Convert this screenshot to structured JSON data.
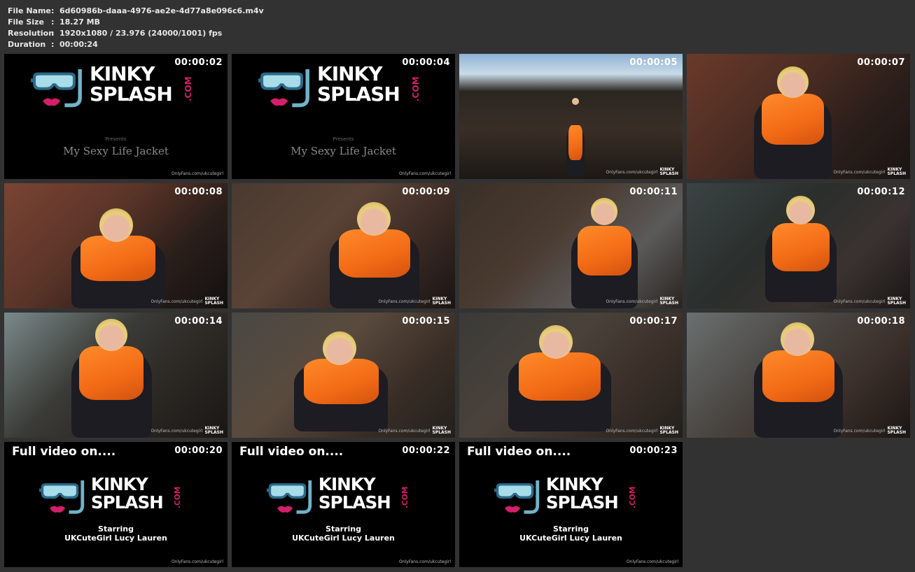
{
  "file_info": {
    "rows": [
      {
        "key": "File Name",
        "sep": ":",
        "value": "6d60986b-daaa-4976-ae2e-4d77a8e096c6.m4v"
      },
      {
        "key": "File Size",
        "sep": ":",
        "value": "18.27 MB"
      },
      {
        "key": "Resolution",
        "sep": ":",
        "value": "1920x1080 / 23.976 (24000/1001) fps"
      },
      {
        "key": "Duration",
        "sep": ":",
        "value": "00:00:24"
      }
    ]
  },
  "brand": {
    "line1": "KINKY",
    "line2": "SPLASH",
    "suffix": ".COM",
    "presents": "Presents",
    "subtitle": "My Sexy Life Jacket",
    "watermark": "OnlyFans.com/ukcutegirl",
    "full_video": "Full video on....",
    "starring_label": "Starring",
    "starring_name": "UKCuteGirl Lucy Lauren",
    "wm_logo1": "KINKY",
    "wm_logo2": "SPLASH"
  },
  "thumbnails": [
    {
      "timestamp": "00:00:02",
      "type": "title"
    },
    {
      "timestamp": "00:00:04",
      "type": "title"
    },
    {
      "timestamp": "00:00:05",
      "type": "scene"
    },
    {
      "timestamp": "00:00:07",
      "type": "scene"
    },
    {
      "timestamp": "00:00:08",
      "type": "scene"
    },
    {
      "timestamp": "00:00:09",
      "type": "scene"
    },
    {
      "timestamp": "00:00:11",
      "type": "scene"
    },
    {
      "timestamp": "00:00:12",
      "type": "scene"
    },
    {
      "timestamp": "00:00:14",
      "type": "scene"
    },
    {
      "timestamp": "00:00:15",
      "type": "scene"
    },
    {
      "timestamp": "00:00:17",
      "type": "scene"
    },
    {
      "timestamp": "00:00:18",
      "type": "scene"
    },
    {
      "timestamp": "00:00:20",
      "type": "end"
    },
    {
      "timestamp": "00:00:22",
      "type": "end"
    },
    {
      "timestamp": "00:00:23",
      "type": "end"
    }
  ],
  "colors": {
    "background": "#323232",
    "brand_pink": "#d41f6a",
    "mask_blue": "#6fb3c9",
    "jacket_orange": "#f26a16"
  }
}
